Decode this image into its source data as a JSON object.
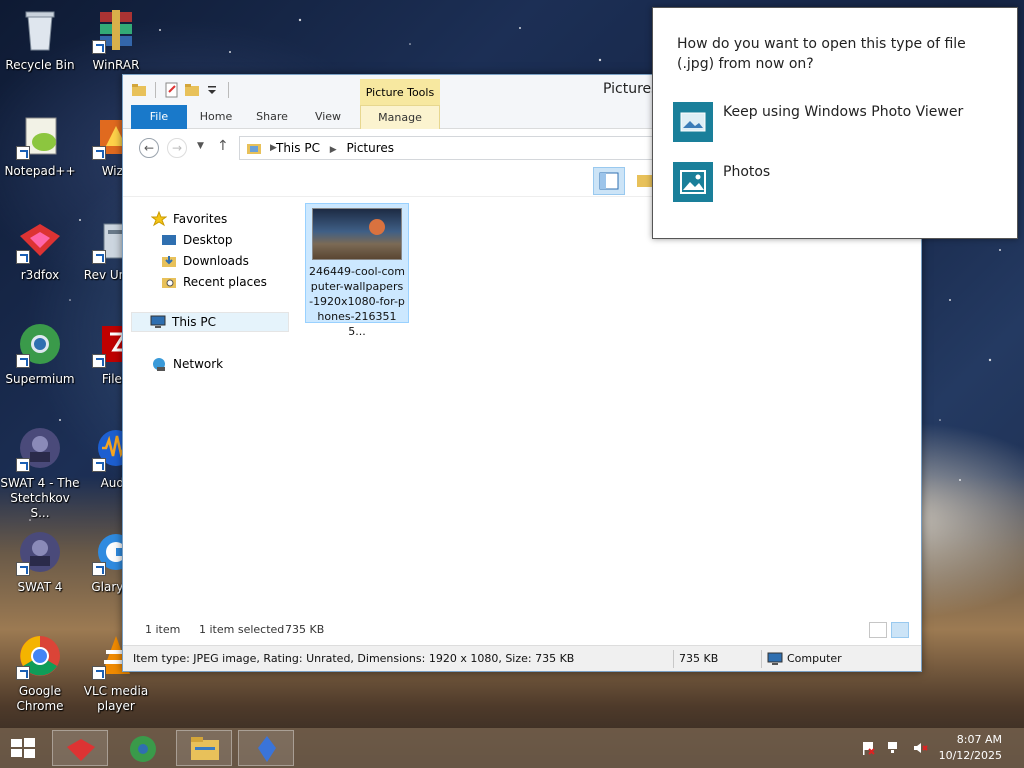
{
  "desktop_icons": [
    {
      "label": "Recycle Bin",
      "icon": "recycle-bin-icon"
    },
    {
      "label": "WinRAR",
      "icon": "winrar-icon"
    },
    {
      "label": "Notepad++",
      "icon": "notepad-plus-plus-icon"
    },
    {
      "label": "WizT",
      "icon": "wiztree-icon"
    },
    {
      "label": "r3dfox",
      "icon": "r3dfox-icon"
    },
    {
      "label": "Rev Uninst",
      "icon": "revo-uninstaller-icon"
    },
    {
      "label": "Supermium",
      "icon": "supermium-icon"
    },
    {
      "label": "FileZ",
      "icon": "filezilla-icon"
    },
    {
      "label": "SWAT 4 - The Stetchkov S...",
      "icon": "swat4-expansion-icon"
    },
    {
      "label": "Auda",
      "icon": "audacity-icon"
    },
    {
      "label": "SWAT 4",
      "icon": "swat4-icon"
    },
    {
      "label": "Glary Ut",
      "icon": "glary-utilities-icon"
    },
    {
      "label": "Google Chrome",
      "icon": "chrome-icon"
    },
    {
      "label": "VLC media player",
      "icon": "vlc-icon"
    }
  ],
  "explorer": {
    "title": "Pictures",
    "picture_tools": "Picture Tools",
    "tabs": {
      "file": "File",
      "home": "Home",
      "share": "Share",
      "view": "View",
      "manage": "Manage"
    },
    "breadcrumb": [
      "This PC",
      "Pictures"
    ],
    "nav": {
      "favorites": "Favorites",
      "desktop": "Desktop",
      "downloads": "Downloads",
      "recent": "Recent places",
      "this_pc": "This PC",
      "network": "Network"
    },
    "file": {
      "name": "246449-cool-computer-wallpapers-1920x1080-for-phones-2163515..."
    },
    "status": {
      "items": "1 item",
      "selected": "1 item selected",
      "size": "735 KB"
    },
    "infobar": {
      "details": "Item type: JPEG image, Rating: Unrated, Dimensions: 1920 x 1080, Size: 735 KB",
      "size": "735 KB",
      "location": "Computer"
    }
  },
  "flyout": {
    "question": "How do you want to open this type of file (.jpg) from now on?",
    "options": [
      {
        "label": "Keep using Windows Photo Viewer",
        "icon": "photo-viewer-icon"
      },
      {
        "label": "Photos",
        "icon": "photos-app-icon"
      }
    ]
  },
  "taskbar": {
    "time": "8:07 AM",
    "date": "10/12/2025",
    "items": [
      "r3dfox-icon",
      "supermium-icon",
      "file-explorer-icon",
      "app-icon"
    ]
  },
  "colors": {
    "accent": "#1979ca",
    "selection": "#cce8ff",
    "tile": "#1a7f9a"
  }
}
